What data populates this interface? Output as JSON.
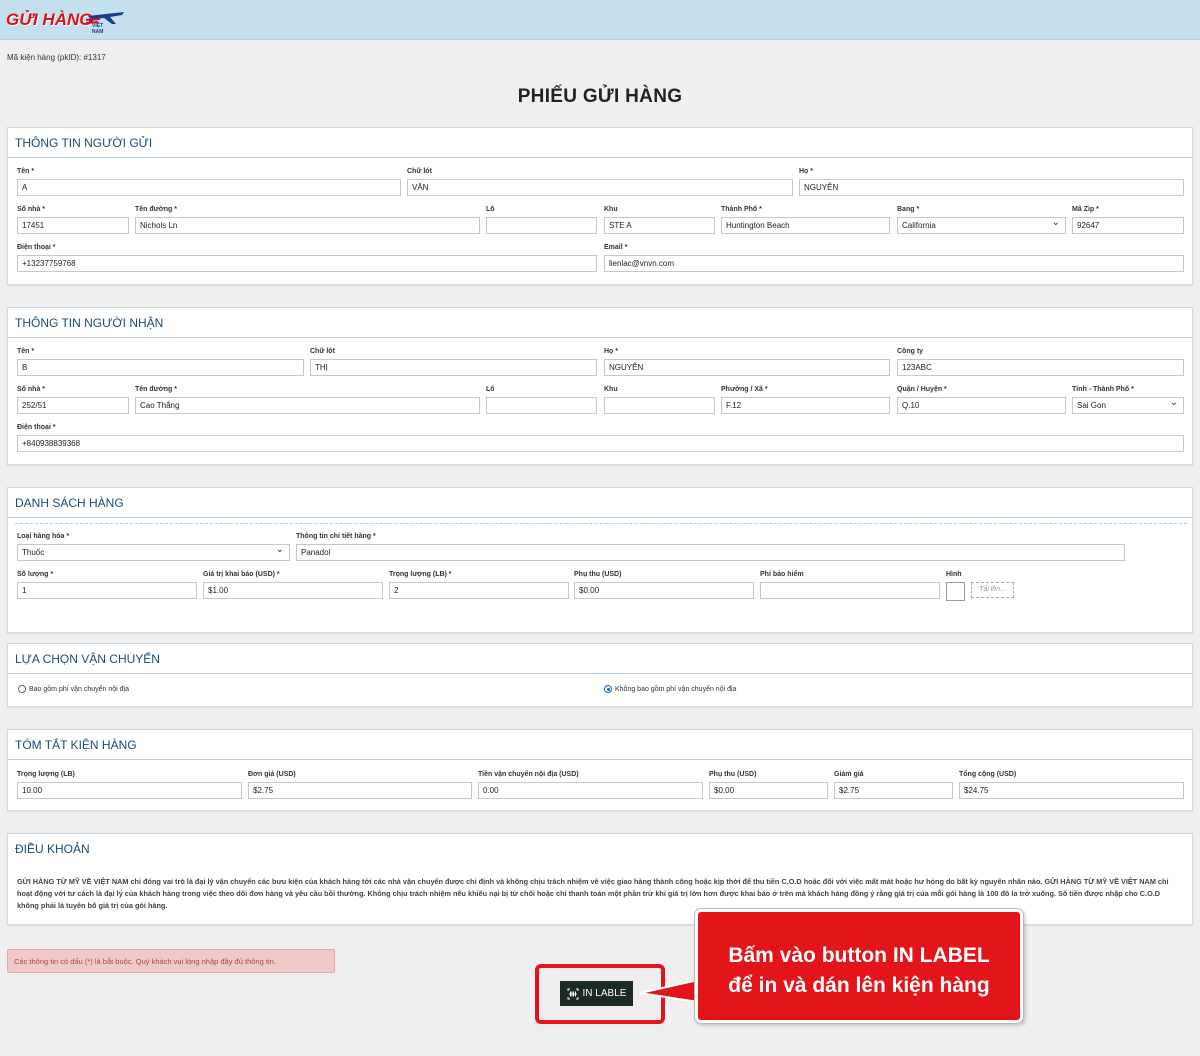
{
  "header": {
    "logo_text": "GỬI HÀNG",
    "logo_sub": "VIỆT NAM"
  },
  "pkid": "Mã kiện hàng (pkID): #1317",
  "title": "PHIẾU GỬI HÀNG",
  "sender": {
    "heading": "THÔNG TIN NGƯỜI GỬI",
    "labels": {
      "first": "Tên *",
      "middle": "Chữ lót",
      "last": "Họ *",
      "house": "Số nhà *",
      "street": "Tên đường *",
      "lot": "Lô",
      "area": "Khu",
      "city": "Thành Phố *",
      "state": "Bang *",
      "zip": "Mã Zip *",
      "phone": "Điện thoại *",
      "email": "Email *"
    },
    "values": {
      "first": "A",
      "middle": "VĂN",
      "last": "NGUYỄN",
      "house": "17451",
      "street": "Nichols Ln",
      "lot": "",
      "area": "STE A",
      "city": "Huntington Beach",
      "state": "California",
      "zip": "92647",
      "phone": "+13237759768",
      "email": "lienlac@vnvn.com"
    }
  },
  "receiver": {
    "heading": "THÔNG TIN NGƯỜI NHẬN",
    "labels": {
      "first": "Tên *",
      "middle": "Chữ lót",
      "last": "Họ *",
      "company": "Công ty",
      "house": "Số nhà *",
      "street": "Tên đường *",
      "lot": "Lô",
      "area": "Khu",
      "ward": "Phường / Xã *",
      "district": "Quận / Huyện *",
      "province": "Tỉnh - Thành Phố *",
      "phone": "Điện thoại *"
    },
    "values": {
      "first": "B",
      "middle": "THỊ",
      "last": "NGUYỄN",
      "company": "123ABC",
      "house": "252/51",
      "street": "Cao Thắng",
      "lot": "",
      "area": "",
      "ward": "F.12",
      "district": "Q.10",
      "province": "Sai Gon",
      "phone": "+840938839368"
    }
  },
  "goods": {
    "heading": "DANH SÁCH HÀNG",
    "labels": {
      "type": "Loại hàng hóa *",
      "detail": "Thông tin chi tiết hàng *",
      "qty": "Số lượng *",
      "declared": "Giá trị khai báo (USD) *",
      "weight": "Trọng lượng (LB) *",
      "surcharge": "Phụ thu (USD)",
      "insurance": "Phí bảo hiểm",
      "image": "Hình"
    },
    "values": {
      "type": "Thuốc",
      "detail": "Panadol",
      "qty": "1",
      "declared": "$1.00",
      "weight": "2",
      "surcharge": "$0.00",
      "insurance": ""
    },
    "upload_label": "Tải lên..."
  },
  "shipping": {
    "heading": "LỰA CHỌN VẬN CHUYỂN",
    "option_include": "Bao gồm phí vận chuyển nội địa",
    "option_exclude": "Không bao gồm phí vận chuyển nội địa",
    "selected": "exclude"
  },
  "summary": {
    "heading": "TÓM TẮT KIỆN HÀNG",
    "labels": {
      "weight": "Trọng lượng (LB)",
      "unit_price": "Đơn giá (USD)",
      "domestic": "Tiền vận chuyển nội địa (USD)",
      "surcharge": "Phụ thu (USD)",
      "discount": "Giảm giá",
      "total": "Tổng cộng (USD)"
    },
    "values": {
      "weight": "10.00",
      "unit_price": "$2.75",
      "domestic": "0.00",
      "surcharge": "$0.00",
      "discount": "$2.75",
      "total": "$24.75"
    }
  },
  "terms": {
    "heading": "ĐIỀU KHOẢN",
    "text": "GỬI HÀNG TỪ MỸ VỀ VIỆT NAM chỉ đóng vai trò là đại lý vận chuyển các bưu kiện của khách hàng tới các nhà vận chuyển được chỉ định và không chịu trách nhiệm về việc giao hàng thành công hoặc kịp thời để thu tiền C.O.D hoặc đối với việc mất mát hoặc hư hỏng do bất kỳ nguyên nhân nào. GỬI HÀNG TỪ MỸ VỀ VIỆT NAM chỉ hoạt động với tư cách là đại lý của khách hàng trong việc theo dõi đơn hàng và yêu cầu bồi thường. Không chịu trách nhiệm nếu khiếu nại bị từ chối hoặc chỉ thanh toán một phần trừ khi giá trị lớn hơn được khai báo ở trên mà khách hàng đồng ý rằng giá trị của mỗi gói hàng là 100 đô la trở xuống. Số tiền được nhập cho C.O.D không phải là tuyên bố giá trị của gói hàng."
  },
  "alert": "Các thông tin có dấu (*) là bắt buộc. Quý khách vui lòng nhập đầy đủ thông tin.",
  "print_button": "IN LABLE",
  "callout": {
    "line1": "Bấm vào button IN LABEL",
    "line2": "để in và dán lên kiện hàng"
  },
  "colors": {
    "topbar": "#c4dfee",
    "heading": "#1b4b7a",
    "callout": "#e3141a",
    "button": "#1b2a24"
  }
}
